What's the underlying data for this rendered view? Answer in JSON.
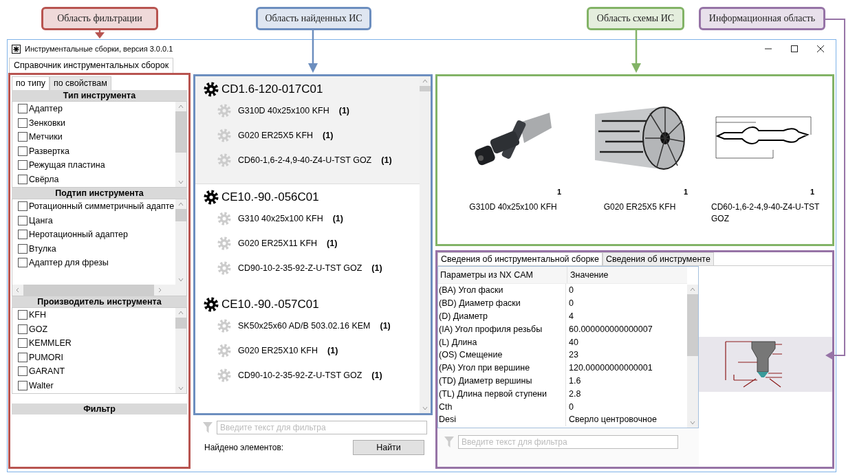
{
  "callouts": [
    {
      "label": "Область фильтрации",
      "color": "#b85450"
    },
    {
      "label": "Область найденных ИС",
      "color": "#6c8ebf"
    },
    {
      "label": "Область схемы ИС",
      "color": "#82b366"
    },
    {
      "label": "Информационная область",
      "color": "#9673a6"
    }
  ],
  "window": {
    "title": "Инструментальные сборки, версия 3.0.0.1"
  },
  "main_tabs": [
    {
      "label": "Справочник инструментальных сборок",
      "selected": true
    }
  ],
  "filter_tabs": [
    {
      "label": "по типу",
      "selected": true
    },
    {
      "label": "по свойствам",
      "selected": false
    }
  ],
  "filter_groups": [
    {
      "title": "Тип инструмента",
      "hscroll": false,
      "items": [
        {
          "label": "Адаптер",
          "checked": false
        },
        {
          "label": "Зенковки",
          "checked": false
        },
        {
          "label": "Метчики",
          "checked": false
        },
        {
          "label": "Развертка",
          "checked": false
        },
        {
          "label": "Режущая пластина",
          "checked": false
        },
        {
          "label": "Свёрла",
          "checked": false
        }
      ]
    },
    {
      "title": "Подтип инструмента",
      "hscroll": true,
      "items": [
        {
          "label": "Ротационный симметричный адапте",
          "checked": false
        },
        {
          "label": "Цанга",
          "checked": false
        },
        {
          "label": "Неротационный адаптер",
          "checked": false
        },
        {
          "label": "Втулка",
          "checked": false
        },
        {
          "label": "Адаптер для фрезы",
          "checked": false
        }
      ]
    },
    {
      "title": "Производитель инструмента",
      "hscroll": false,
      "items": [
        {
          "label": "KFH",
          "checked": false
        },
        {
          "label": "GOZ",
          "checked": false
        },
        {
          "label": "KEMMLER",
          "checked": false
        },
        {
          "label": "PUMORI",
          "checked": false
        },
        {
          "label": "GARANT",
          "checked": false
        },
        {
          "label": "Walter",
          "checked": false
        }
      ]
    }
  ],
  "filter_section": {
    "title": "Фильтр"
  },
  "assemblies": [
    {
      "name": "CD1.6-120-017C01",
      "selected": true,
      "components": [
        {
          "name": "G310D 40x25x100 KFH",
          "count": "(1)"
        },
        {
          "name": "G020 ER25X5 KFH",
          "count": "(1)"
        },
        {
          "name": "CD60-1,6-2-4,9-40-Z4-U-TST GOZ",
          "count": "(1)"
        }
      ]
    },
    {
      "name": "CE10.-90.-056C01",
      "selected": false,
      "components": [
        {
          "name": "G310 40x25x100 KFH",
          "count": "(1)"
        },
        {
          "name": "G020 ER25X11 KFH",
          "count": "(1)"
        },
        {
          "name": "CD90-10-2-35-92-Z-U-TST GOZ",
          "count": "(1)"
        }
      ]
    },
    {
      "name": "CE10.-90.-057C01",
      "selected": false,
      "components": [
        {
          "name": "SK50x25x60 AD/B 503.02.16 KEM",
          "count": "(1)"
        },
        {
          "name": "G020 ER25X10 KFH",
          "count": "(1)"
        },
        {
          "name": "CD90-10-2-35-92-Z-U-TST GOZ",
          "count": "(1)"
        }
      ]
    }
  ],
  "search": {
    "placeholder": "Введите текст для фильтра"
  },
  "found_label": "Найдено элементов:",
  "find_button": "Найти",
  "scheme_items": [
    {
      "kind": "holder",
      "count": "1",
      "caption": "G310D 40x25x100 KFH"
    },
    {
      "kind": "collet",
      "count": "1",
      "caption": "G020 ER25X5 KFH"
    },
    {
      "kind": "drill",
      "count": "1",
      "caption": "CD60-1,6-2-4,9-40-Z4-U-TST GOZ"
    }
  ],
  "info_tabs": [
    {
      "label": "Сведения об инструментальной сборке",
      "selected": true
    },
    {
      "label": "Сведения об инструменте",
      "selected": false
    }
  ],
  "params_table": {
    "columns": [
      "Параметры из NX CAM",
      "Значение"
    ],
    "rows": [
      [
        "(BA) Угол фаски",
        "0"
      ],
      [
        "(BD) Диаметр фаски",
        "0"
      ],
      [
        "(D) Диаметр",
        "4"
      ],
      [
        "(IA) Угол профиля резьбы",
        "60.000000000000007"
      ],
      [
        "(L) Длина",
        "40"
      ],
      [
        "(OS) Смещение",
        "23"
      ],
      [
        "(PA) Угол при вершине",
        "120.00000000000001"
      ],
      [
        "(TD) Диаметр вершины",
        "1.6"
      ],
      [
        "(TL) Длина первой ступени",
        "2.8"
      ],
      [
        "Cth",
        "0"
      ],
      [
        "Desi",
        "Сверло центровочное"
      ]
    ]
  },
  "param_filter": {
    "placeholder": "Введите текст для фильтра"
  }
}
